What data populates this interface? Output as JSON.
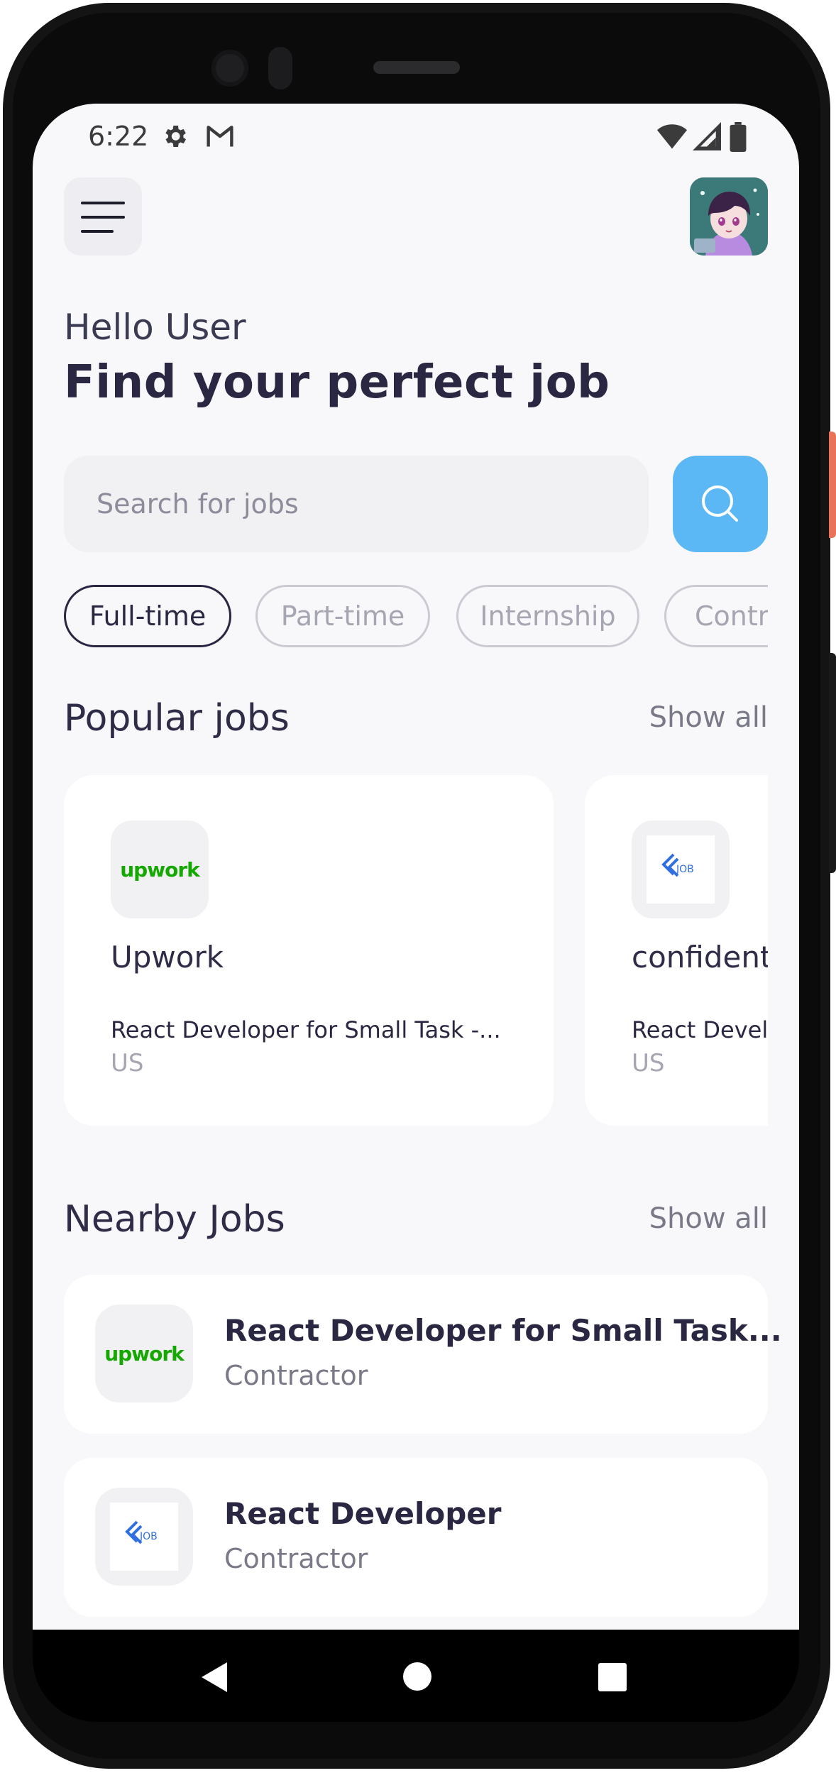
{
  "status_bar": {
    "time": "6:22",
    "icons": [
      "settings-icon",
      "gmail-icon",
      "wifi-icon",
      "signal-icon",
      "battery-icon"
    ]
  },
  "header": {
    "greeting": "Hello User",
    "headline": "Find your perfect job"
  },
  "search": {
    "placeholder": "Search for jobs",
    "value": ""
  },
  "chips": [
    {
      "label": "Full-time",
      "active": true
    },
    {
      "label": "Part-time",
      "active": false
    },
    {
      "label": "Internship",
      "active": false
    },
    {
      "label": "Contractor",
      "active": false
    }
  ],
  "popular": {
    "title": "Popular jobs",
    "show_all": "Show all",
    "cards": [
      {
        "company": "Upwork",
        "logo_text": "upwork",
        "title": "React Developer for Small Task -...",
        "location": "US"
      },
      {
        "company": "confidential",
        "logo_text": "JOB",
        "title": "React Developer",
        "location": "US"
      }
    ]
  },
  "nearby": {
    "title": "Nearby Jobs",
    "show_all": "Show all",
    "items": [
      {
        "title": "React Developer for Small Task...",
        "type": "Contractor",
        "logo_text": "upwork"
      },
      {
        "title": "React Developer",
        "type": "Contractor",
        "logo_text": "JOB"
      }
    ]
  },
  "colors": {
    "primary_text": "#2a2742",
    "accent": "#5cb8f5",
    "background": "#f8f8fa",
    "upwork_green": "#14a800",
    "job_blue": "#2f6fe0"
  }
}
